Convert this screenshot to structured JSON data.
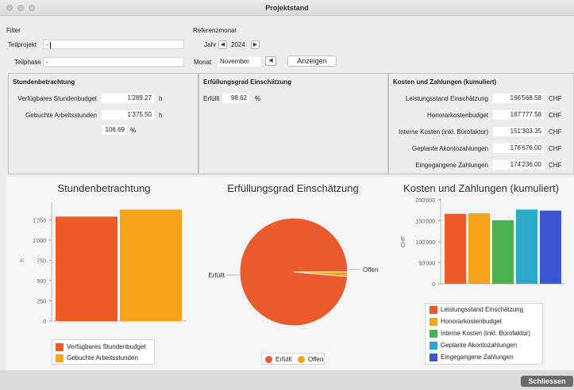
{
  "window": {
    "title": "Projektstand"
  },
  "filter": {
    "label": "Filter",
    "teilprojekt_label": "Teilprojekt",
    "teilprojekt_value": "-",
    "teilphase_label": "Teilphase",
    "teilphase_value": "-"
  },
  "referenzmonat": {
    "label": "Referenzmonat",
    "jahr_label": "Jahr",
    "jahr_value": "2024",
    "monat_label": "Monat",
    "monat_value": "November",
    "anzeigen_label": "Anzeigen"
  },
  "stunden": {
    "title": "Stundenbetrachtung",
    "budget_label": "Verfügbares Stundenbudget",
    "budget_value": "1'289.27",
    "budget_unit": "h",
    "gebucht_label": "Gebuchte Arbeitsstunden",
    "gebucht_value": "1'375.50",
    "gebucht_unit": "h",
    "prozent_value": "106.69",
    "prozent_unit": "%"
  },
  "erfuellung": {
    "title": "Erfüllungsgrad Einschätzung",
    "label": "Erfüllt",
    "value": "98.62",
    "unit": "%"
  },
  "kosten": {
    "title": "Kosten und Zahlungen (kumuliert)",
    "rows": [
      {
        "label": "Leistungsstand Einschätzung",
        "value": "166'568.58",
        "unit": "CHF"
      },
      {
        "label": "Honorarkostenbudget",
        "value": "167'777.58",
        "unit": "CHF"
      },
      {
        "label": "Interne Kosten (inkl. Bürofaktor)",
        "value": "151'303.35",
        "unit": "CHF"
      },
      {
        "label": "Geplante Akontozahlungen",
        "value": "176'676.00",
        "unit": "CHF"
      },
      {
        "label": "Eingegangene Zahlungen",
        "value": "174'236.00",
        "unit": "CHF"
      }
    ]
  },
  "chart_data": [
    {
      "type": "bar",
      "title": "Stundenbetrachtung",
      "ylabel": "h",
      "ylim": [
        0,
        1400
      ],
      "yticks": [
        "0",
        "250",
        "500",
        "750",
        "1'000",
        "1'250"
      ],
      "series": [
        {
          "name": "Verfügbares Stundenbudget",
          "value": 1289.27,
          "color": "#f05a28"
        },
        {
          "name": "Gebuchte Arbeitsstunden",
          "value": 1375.5,
          "color": "#f5a31a"
        }
      ]
    },
    {
      "type": "pie",
      "title": "Erfüllungsgrad Einschätzung",
      "slices": [
        {
          "name": "Erfüllt",
          "value": 98.62,
          "color": "#e95b2c"
        },
        {
          "name": "Offen",
          "value": 1.38,
          "color": "#f5a31a"
        }
      ]
    },
    {
      "type": "bar",
      "title": "Kosten und Zahlungen (kumuliert)",
      "ylabel": "CHF",
      "ylim": [
        0,
        200000
      ],
      "yticks": [
        "0",
        "50'000",
        "100'000",
        "150'000",
        "200'000"
      ],
      "series": [
        {
          "name": "Leistungsstand Einschätzung",
          "value": 166568.58,
          "color": "#f05a28"
        },
        {
          "name": "Honorarkostenbudget",
          "value": 167777.58,
          "color": "#f5a31a"
        },
        {
          "name": "Interne Kosten (inkl. Bürofaktor)",
          "value": 151303.35,
          "color": "#4cb050"
        },
        {
          "name": "Geplante Akontozahlungen",
          "value": 176676.0,
          "color": "#2ca8c8"
        },
        {
          "name": "Eingegangene Zahlungen",
          "value": 174236.0,
          "color": "#3c55d0"
        }
      ]
    }
  ],
  "footer": {
    "close_label": "Schliessen"
  }
}
